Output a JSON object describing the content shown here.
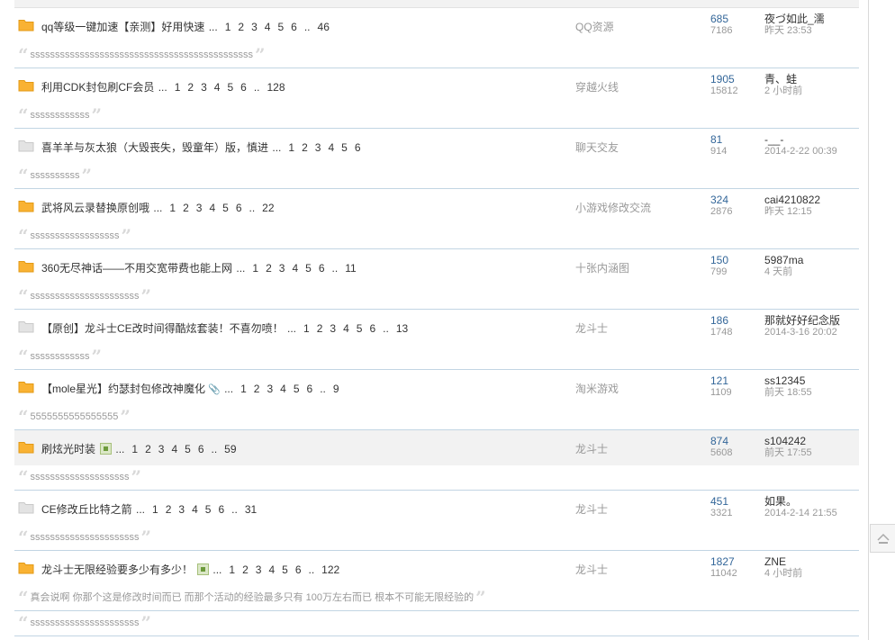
{
  "threads": [
    {
      "type": "hot",
      "title": "qq等级一键加速【亲测】好用快速",
      "pages": [
        "1",
        "2",
        "3",
        "4",
        "5",
        "6",
        "..",
        "46"
      ],
      "forum": "QQ资源",
      "replies": "685",
      "views": "7186",
      "last_user": "夜づ如此_濡",
      "last_time": "昨天 23:53",
      "quote": "sssssssssssssssssssssssssssssssssssssssssssss",
      "badge": false,
      "clip": false,
      "highlight": false
    },
    {
      "type": "hot",
      "title": "利用CDK封包刷CF会员",
      "pages": [
        "1",
        "2",
        "3",
        "4",
        "5",
        "6",
        "..",
        "128"
      ],
      "forum": "穿越火线",
      "replies": "1905",
      "views": "15812",
      "last_user": "青、蛙",
      "last_time": "2 小时前",
      "quote": "ssssssssssss",
      "badge": false,
      "clip": false,
      "highlight": false
    },
    {
      "type": "normal",
      "title": "喜羊羊与灰太狼（大毁丧失，毁童年）版，慎进",
      "pages": [
        "1",
        "2",
        "3",
        "4",
        "5",
        "6"
      ],
      "forum": "聊天交友",
      "replies": "81",
      "views": "914",
      "last_user": "-__-",
      "last_time": "2014-2-22 00:39",
      "quote": "ssssssssss",
      "badge": false,
      "clip": false,
      "highlight": false
    },
    {
      "type": "hot",
      "title": "武将风云录替换原创哦",
      "pages": [
        "1",
        "2",
        "3",
        "4",
        "5",
        "6",
        "..",
        "22"
      ],
      "forum": "小游戏修改交流",
      "replies": "324",
      "views": "2876",
      "last_user": "cai4210822",
      "last_time": "昨天 12:15",
      "quote": "ssssssssssssssssss",
      "badge": false,
      "clip": false,
      "highlight": false
    },
    {
      "type": "hot",
      "title": "360无尽神话——不用交宽带费也能上网",
      "pages": [
        "1",
        "2",
        "3",
        "4",
        "5",
        "6",
        "..",
        "11"
      ],
      "forum": "十张内涵图",
      "replies": "150",
      "views": "799",
      "last_user": "5987ma",
      "last_time": "4 天前",
      "quote": "ssssssssssssssssssssss",
      "badge": false,
      "clip": false,
      "highlight": false
    },
    {
      "type": "normal",
      "title": "【原创】龙斗士CE改时间得酷炫套装！不喜勿喷！",
      "pages": [
        "1",
        "2",
        "3",
        "4",
        "5",
        "6",
        "..",
        "13"
      ],
      "forum": "龙斗士",
      "replies": "186",
      "views": "1748",
      "last_user": "那就好好纪念版",
      "last_time": "2014-3-16 20:02",
      "quote": "ssssssssssss",
      "badge": false,
      "clip": false,
      "highlight": false
    },
    {
      "type": "hot",
      "title": "【mole星光】约瑟封包修改神魔化",
      "pages": [
        "1",
        "2",
        "3",
        "4",
        "5",
        "6",
        "..",
        "9"
      ],
      "forum": "淘米游戏",
      "replies": "121",
      "views": "1109",
      "last_user": "ss12345",
      "last_time": "前天 18:55",
      "quote": "5555555555555555",
      "badge": false,
      "clip": true,
      "highlight": false
    },
    {
      "type": "hot",
      "title": "刷炫光时装",
      "pages": [
        "1",
        "2",
        "3",
        "4",
        "5",
        "6",
        "..",
        "59"
      ],
      "forum": "龙斗士",
      "replies": "874",
      "views": "5608",
      "last_user": "s104242",
      "last_time": "前天 17:55",
      "quote": "ssssssssssssssssssss",
      "badge": true,
      "clip": false,
      "highlight": true
    },
    {
      "type": "normal",
      "title": "CE修改丘比特之箭",
      "pages": [
        "1",
        "2",
        "3",
        "4",
        "5",
        "6",
        "..",
        "31"
      ],
      "forum": "龙斗士",
      "replies": "451",
      "views": "3321",
      "last_user": "如果。",
      "last_time": "2014-2-14 21:55",
      "quote": "ssssssssssssssssssssss",
      "badge": false,
      "clip": false,
      "highlight": false
    },
    {
      "type": "hot",
      "title": "龙斗士无限经验要多少有多少！",
      "pages": [
        "1",
        "2",
        "3",
        "4",
        "5",
        "6",
        "..",
        "122"
      ],
      "forum": "龙斗士",
      "replies": "1827",
      "views": "11042",
      "last_user": "ZNE",
      "last_time": "4 小时前",
      "quote": "真会说啊 你那个这是修改时间而已 而那个活动的经验最多只有 100万左右而已 根本不可能无限经验的",
      "badge": true,
      "clip": false,
      "highlight": false
    }
  ],
  "extra_quote": "ssssssssssssssssssssss",
  "ellipsis": "...",
  "colors": {
    "hot_folder": "#f9b233",
    "normal_folder": "#e3e3e3",
    "link": "#336699",
    "border": "#c2d5e3"
  },
  "icons": {
    "folder": "folder-icon",
    "badge": "image-attachment-icon",
    "clip": "paperclip-icon",
    "back_to_top": "back-to-top-icon"
  }
}
